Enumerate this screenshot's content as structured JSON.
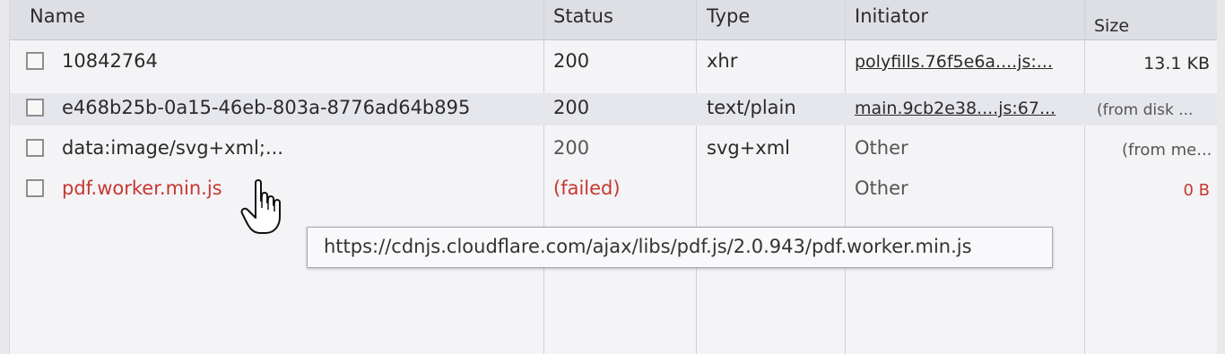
{
  "columns": {
    "name": "Name",
    "status": "Status",
    "type": "Type",
    "initiator": "Initiator",
    "size": "Size"
  },
  "rows": [
    {
      "name": "10842764",
      "status": "200",
      "type": "xhr",
      "initiator": "polyfills.76f5e6a....js:...",
      "size": "13.1 KB"
    },
    {
      "name": "e468b25b-0a15-46eb-803a-8776ad64b895",
      "status": "200",
      "type": "text/plain",
      "initiator": "main.9cb2e38....js:67...",
      "size": "(from disk ..."
    },
    {
      "name": "data:image/svg+xml;...",
      "status": "200",
      "type": "svg+xml",
      "initiator": "Other",
      "size": "(from me..."
    },
    {
      "name": "pdf.worker.min.js",
      "status": "(failed)",
      "type": "",
      "initiator": "Other",
      "size": "0 B"
    }
  ],
  "tooltip": {
    "text": "https://cdnjs.cloudflare.com/ajax/libs/pdf.js/2.0.943/pdf.worker.min.js"
  },
  "colors": {
    "failed": "#c8372f",
    "header_bg": "#dedfe4",
    "panel_bg": "#f4f4f7"
  },
  "cursor": {
    "icon": "hand-pointer-icon"
  }
}
